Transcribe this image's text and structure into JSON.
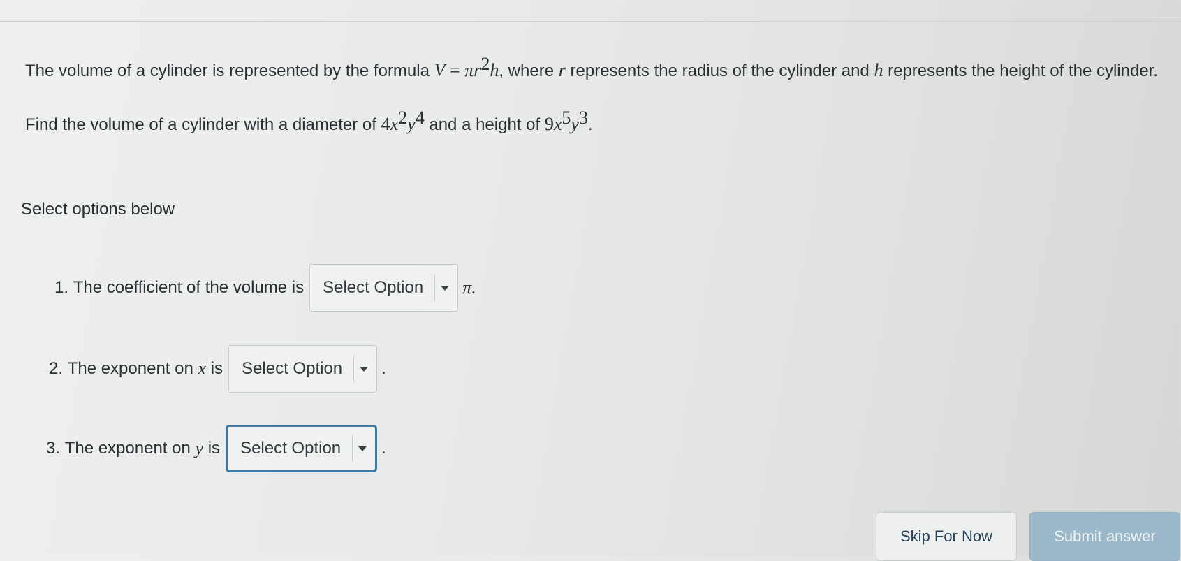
{
  "question": {
    "intro_a": "The volume of a cylinder is represented by the formula",
    "formula_V": "V",
    "formula_eq": " = ",
    "formula_pi": "π",
    "formula_r": "r",
    "formula_exp2": "2",
    "formula_h": "h",
    "intro_b": ", where",
    "var_r": "r",
    "intro_c": "represents the radius of the cylinder and",
    "var_h": "h",
    "intro_d": "represents the height of the cylinder.",
    "find_a": "Find the volume of a cylinder with a diameter of",
    "diam_coef": "4",
    "diam_x": "x",
    "diam_x_exp": "2",
    "diam_y": "y",
    "diam_y_exp": "4",
    "find_b": "and a height of",
    "height_coef": "9",
    "height_x": "x",
    "height_x_exp": "5",
    "height_y": "y",
    "height_y_exp": "3",
    "find_end": "."
  },
  "select_label": "Select options below",
  "items": [
    {
      "number": "1.",
      "text": "The coefficient of the volume is",
      "select": "Select Option",
      "suffix": "π."
    },
    {
      "number": "2.",
      "text_a": "The exponent on",
      "var": "x",
      "text_b": "is",
      "select": "Select Option",
      "suffix": "."
    },
    {
      "number": "3.",
      "text_a": "The exponent on",
      "var": "y",
      "text_b": "is",
      "select": "Select Option",
      "suffix": "."
    }
  ],
  "buttons": {
    "skip": "Skip For Now",
    "submit": "Submit answer"
  },
  "colors": {
    "focus_border": "#3f79a8",
    "submit_bg": "#9bb8cb",
    "skip_text": "#26405b"
  }
}
